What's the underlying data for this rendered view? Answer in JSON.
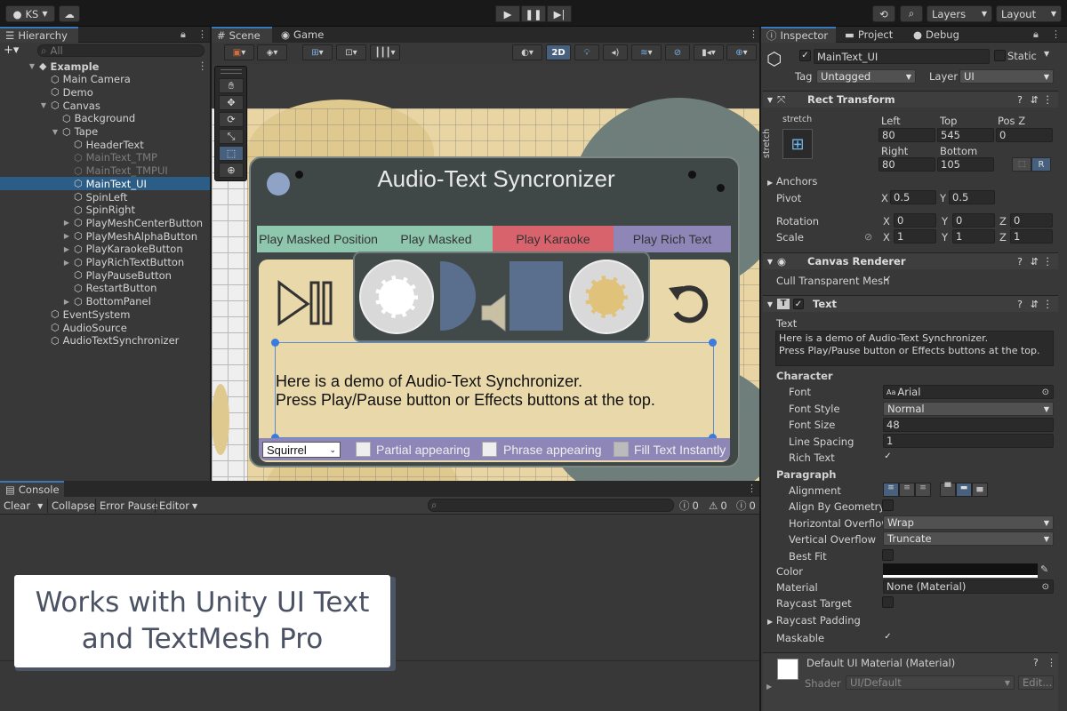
{
  "topbar": {
    "account": "KS",
    "layers": "Layers",
    "layout": "Layout"
  },
  "hierarchy": {
    "tab": "Hierarchy",
    "search_placeholder": "All",
    "items": [
      {
        "label": "Example",
        "depth": 0,
        "bold": true
      },
      {
        "label": "Main Camera",
        "depth": 1
      },
      {
        "label": "Demo",
        "depth": 1
      },
      {
        "label": "Canvas",
        "depth": 1
      },
      {
        "label": "Background",
        "depth": 2
      },
      {
        "label": "Tape",
        "depth": 2
      },
      {
        "label": "HeaderText",
        "depth": 3
      },
      {
        "label": "MainText_TMP",
        "depth": 3,
        "dim": true
      },
      {
        "label": "MainText_TMPUI",
        "depth": 3,
        "dim": true
      },
      {
        "label": "MainText_UI",
        "depth": 3,
        "selected": true
      },
      {
        "label": "SpinLeft",
        "depth": 3
      },
      {
        "label": "SpinRight",
        "depth": 3
      },
      {
        "label": "PlayMeshCenterButton",
        "depth": 3
      },
      {
        "label": "PlayMeshAlphaButton",
        "depth": 3
      },
      {
        "label": "PlayKaraokeButton",
        "depth": 3
      },
      {
        "label": "PlayRichTextButton",
        "depth": 3
      },
      {
        "label": "PlayPauseButton",
        "depth": 3
      },
      {
        "label": "RestartButton",
        "depth": 3
      },
      {
        "label": "BottomPanel",
        "depth": 3
      },
      {
        "label": "EventSystem",
        "depth": 1
      },
      {
        "label": "AudioSource",
        "depth": 1
      },
      {
        "label": "AudioTextSynchronizer",
        "depth": 1
      }
    ]
  },
  "scene": {
    "tab_scene": "Scene",
    "tab_game": "Game",
    "btn_2d": "2D",
    "title": "Audio-Text Syncronizer",
    "effect_buttons": [
      {
        "label": "Play Masked Position",
        "color": "#8fc7ae"
      },
      {
        "label": "Play Masked",
        "color": "#8fc7ae"
      },
      {
        "label": "Play Karaoke",
        "color": "#d9636d"
      },
      {
        "label": "Play Rich Text",
        "color": "#8f86b8"
      }
    ],
    "main_text_1": "Here is a demo of Audio-Text Synchronizer.",
    "main_text_2": "Press Play/Pause button or Effects buttons at the top.",
    "dropdown": "Squirrel",
    "options": [
      "Partial appearing",
      "Phrase appearing",
      "Fill Text Instantly"
    ]
  },
  "console": {
    "tab": "Console",
    "clear": "Clear",
    "collapse": "Collapse",
    "error_pause": "Error Pause",
    "editor": "Editor",
    "counts": [
      "0",
      "0",
      "0"
    ]
  },
  "promo": {
    "line1": "Works with Unity UI Text",
    "line2": "and TextMesh Pro"
  },
  "inspector": {
    "tabs": [
      "Inspector",
      "Project",
      "Debug"
    ],
    "object_name": "MainText_UI",
    "static": "Static",
    "tag_label": "Tag",
    "tag": "Untagged",
    "layer_label": "Layer",
    "layer": "UI",
    "rect_transform": {
      "title": "Rect Transform",
      "stretch": "stretch",
      "left_label": "Left",
      "left": "80",
      "top_label": "Top",
      "top": "545",
      "posz_label": "Pos Z",
      "posz": "0",
      "right_label": "Right",
      "right": "80",
      "bottom_label": "Bottom",
      "bottom": "105",
      "r": "R",
      "anchors": "Anchors",
      "pivot": "Pivot",
      "pivot_x": "0.5",
      "pivot_y": "0.5",
      "rotation": "Rotation",
      "rot_x": "0",
      "rot_y": "0",
      "rot_z": "0",
      "scale": "Scale",
      "scale_x": "1",
      "scale_y": "1",
      "scale_z": "1"
    },
    "canvas_renderer": {
      "title": "Canvas Renderer",
      "cull": "Cull Transparent Mesh"
    },
    "text": {
      "title": "Text",
      "text_label": "Text",
      "text_value_1": "Here is a demo of Audio-Text Synchronizer.",
      "text_value_2": "Press Play/Pause button or Effects buttons at the top.",
      "character": "Character",
      "font_label": "Font",
      "font": "Arial",
      "font_style_label": "Font Style",
      "font_style": "Normal",
      "font_size_label": "Font Size",
      "font_size": "48",
      "line_spacing_label": "Line Spacing",
      "line_spacing": "1",
      "rich_text_label": "Rich Text",
      "paragraph": "Paragraph",
      "alignment_label": "Alignment",
      "align_geom_label": "Align By Geometry",
      "h_overflow_label": "Horizontal Overflow",
      "h_overflow": "Wrap",
      "v_overflow_label": "Vertical Overflow",
      "v_overflow": "Truncate",
      "best_fit_label": "Best Fit",
      "color_label": "Color",
      "material_label": "Material",
      "material": "None (Material)",
      "raycast_target_label": "Raycast Target",
      "raycast_padding_label": "Raycast Padding",
      "maskable_label": "Maskable"
    },
    "material_block": {
      "title": "Default UI Material (Material)",
      "shader_label": "Shader",
      "shader": "UI/Default",
      "edit": "Edit..."
    }
  }
}
